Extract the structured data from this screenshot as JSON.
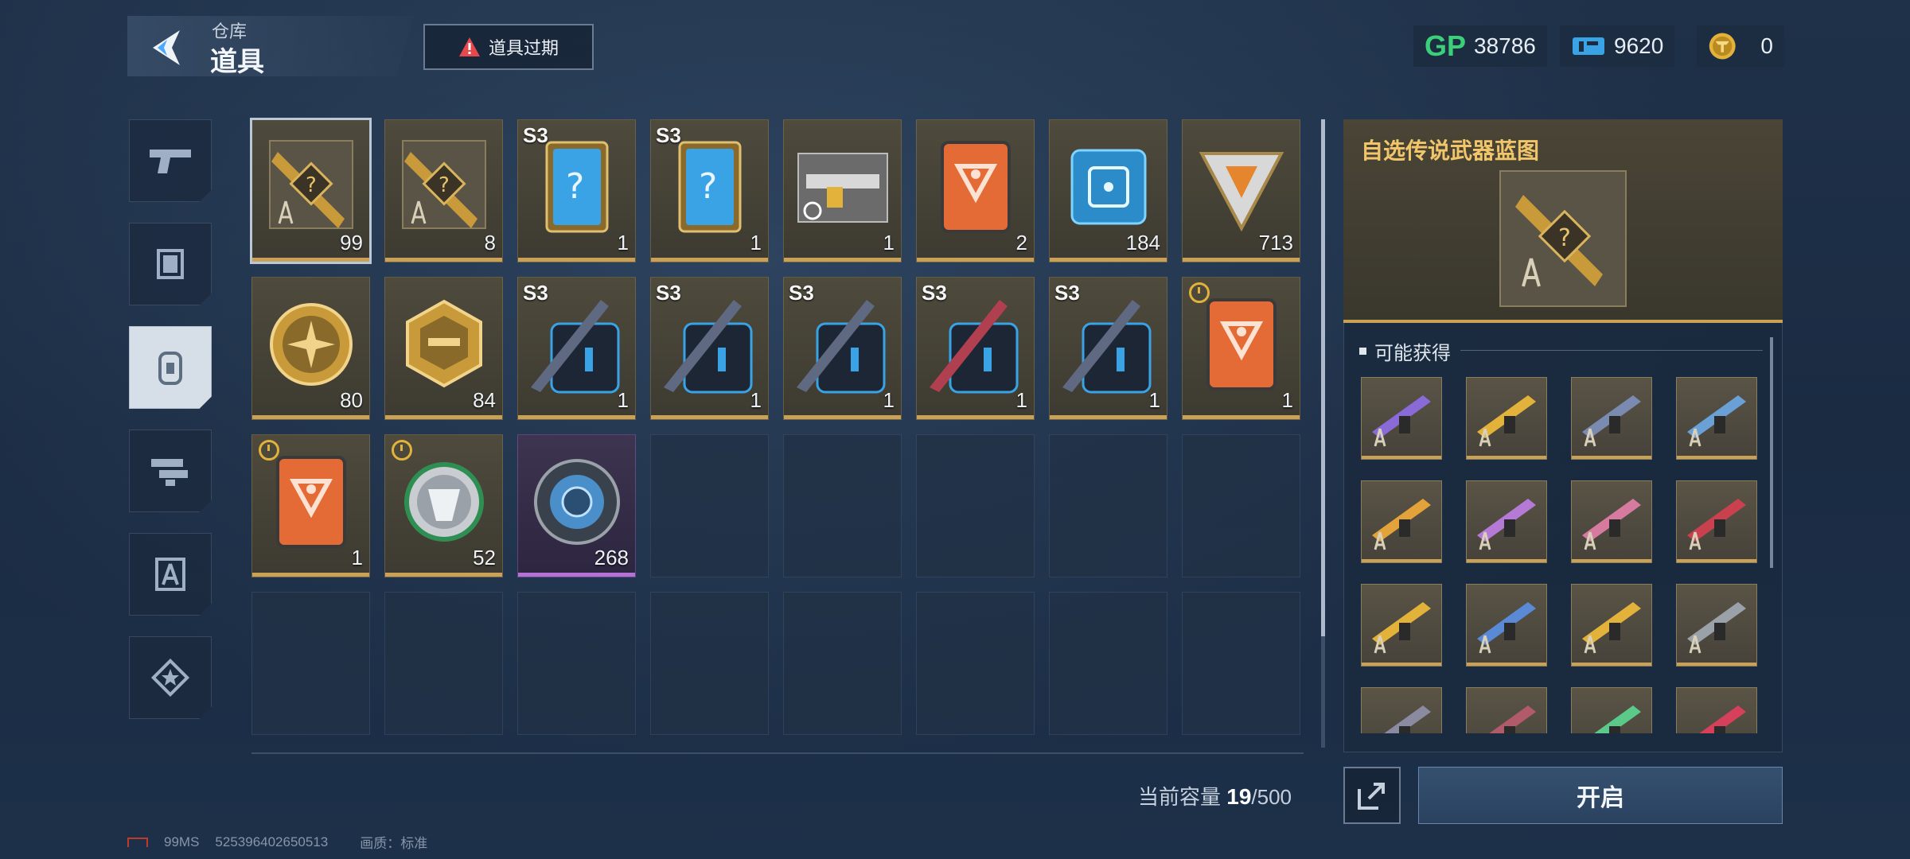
{
  "header": {
    "breadcrumb_top": "仓库",
    "breadcrumb_title": "道具",
    "expire_label": "道具过期"
  },
  "currencies": [
    {
      "icon": "gp-icon",
      "value": "38786"
    },
    {
      "icon": "ticket-icon",
      "value": "9620"
    },
    {
      "icon": "coin-icon",
      "value": "0"
    }
  ],
  "sidebar": {
    "tabs": [
      {
        "icon": "pistol-icon"
      },
      {
        "icon": "frame-icon"
      },
      {
        "icon": "item-icon",
        "active": true
      },
      {
        "icon": "drone-icon"
      },
      {
        "icon": "blueprint-icon"
      },
      {
        "icon": "star-badge-icon"
      }
    ]
  },
  "items": [
    {
      "art": "blueprint-gold",
      "count": "99",
      "tag": "",
      "clock": false,
      "selected": true
    },
    {
      "art": "blueprint-gold",
      "count": "8",
      "tag": "",
      "clock": false
    },
    {
      "art": "mystery-card-blue",
      "count": "1",
      "tag": "S3",
      "clock": false
    },
    {
      "art": "mystery-card-blue",
      "count": "1",
      "tag": "S3",
      "clock": false
    },
    {
      "art": "rifle-card",
      "count": "1",
      "tag": "",
      "clock": false
    },
    {
      "art": "orange-card",
      "count": "2",
      "tag": "",
      "clock": false
    },
    {
      "art": "chip",
      "count": "184",
      "tag": "",
      "clock": false
    },
    {
      "art": "triangle-gem",
      "count": "713",
      "tag": "",
      "clock": false
    },
    {
      "art": "gold-medal",
      "count": "80",
      "tag": "",
      "clock": false
    },
    {
      "art": "hex-badge",
      "count": "84",
      "tag": "",
      "clock": false
    },
    {
      "art": "weapon-crate",
      "count": "1",
      "tag": "S3",
      "clock": false
    },
    {
      "art": "weapon-crate",
      "count": "1",
      "tag": "S3",
      "clock": false
    },
    {
      "art": "weapon-crate",
      "count": "1",
      "tag": "S3",
      "clock": false
    },
    {
      "art": "weapon-crate-red",
      "count": "1",
      "tag": "S3",
      "clock": false
    },
    {
      "art": "weapon-crate",
      "count": "1",
      "tag": "S3",
      "clock": false
    },
    {
      "art": "orange-card",
      "count": "1",
      "tag": "",
      "clock": true
    },
    {
      "art": "orange-card",
      "count": "1",
      "tag": "",
      "clock": true
    },
    {
      "art": "silver-medal",
      "count": "52",
      "tag": "",
      "clock": true
    },
    {
      "art": "blue-disc",
      "count": "268",
      "tag": "",
      "clock": false,
      "purple": true
    }
  ],
  "empty_slots": 13,
  "panel": {
    "title": "自选传说武器蓝图",
    "rewards_header": "可能获得",
    "reward_count": 16
  },
  "bottom": {
    "capacity_label": "当前容量",
    "capacity_current": "19",
    "capacity_max": "/500",
    "open_label": "开启"
  },
  "footer": {
    "ping": "99MS",
    "uid": "525396402650513",
    "quality": "画质：标准"
  },
  "colors": {
    "gold": "#c9a258",
    "title_gold": "#f1c56a",
    "alert_red": "#e5484d",
    "gp_green": "#3ccf7a",
    "ticket_blue": "#3aa3e6",
    "coin_gold": "#e2b23a"
  }
}
